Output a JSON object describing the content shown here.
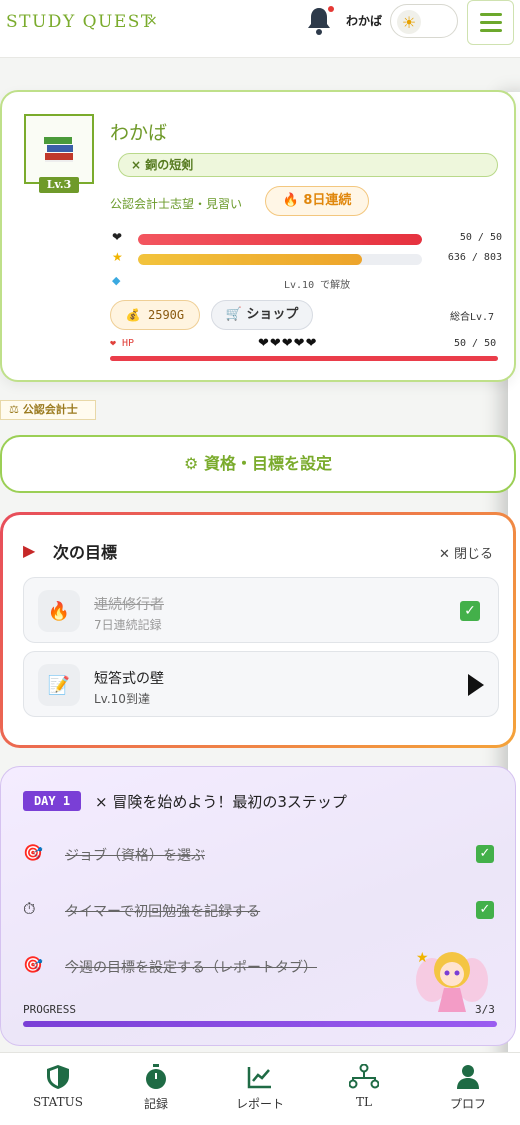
{
  "header": {
    "app_title": "STUDY QUEST",
    "title_mark": "×",
    "user_name": "わかば",
    "theme_icon": "sun-icon",
    "menu_icon": "hamburger-icon"
  },
  "profile": {
    "name": "わかば",
    "level_badge": "Lv.3",
    "title": "× 銅の短剣",
    "subtitle": "公認会計士志望・見習い",
    "streak": "🔥 8日連続",
    "hp_row_value": "50 / 50",
    "hp_fill": 1.0,
    "exp_value": "636 / 803",
    "exp_fill": 0.79,
    "unlock_note": "Lv.10 で解放",
    "gold": "💰 2590G",
    "shop": "🛒 ショップ",
    "total_level": "総合Lv.7",
    "hp_label": "❤ HP",
    "hearts": "❤❤❤❤❤",
    "hp_value": "50 / 50"
  },
  "certificate_tag": "⚖ 公認会計士",
  "set_goal_button": "⚙ 資格・目標を設定",
  "next_goals": {
    "title": "次の目標",
    "close_label": "✕ 閉じる",
    "items": [
      {
        "icon": "🔥",
        "name": "連続修行者",
        "sub": "7日連続記録",
        "done": true
      },
      {
        "icon": "📝",
        "name": "短答式の壁",
        "sub": "Lv.10到達",
        "done": false
      }
    ]
  },
  "day_card": {
    "badge": "DAY 1",
    "title": "× 冒険を始めよう！最初の3ステップ",
    "steps": [
      {
        "icon": "🎯",
        "text": "ジョブ（資格）を選ぶ"
      },
      {
        "icon": "⏱",
        "text": "タイマーで初回勉強を記録する"
      },
      {
        "icon": "🎯",
        "text": "今週の目標を設定する（レポートタブ）"
      }
    ],
    "progress_label": "PROGRESS",
    "progress_value": "3/3",
    "progress_fill": 1.0
  },
  "nav": [
    {
      "label": "STATUS",
      "icon": "shield-icon"
    },
    {
      "label": "記録",
      "icon": "stopwatch-icon"
    },
    {
      "label": "レポート",
      "icon": "chart-icon"
    },
    {
      "label": "TL",
      "icon": "network-icon"
    },
    {
      "label": "プロフ",
      "icon": "person-icon"
    }
  ]
}
